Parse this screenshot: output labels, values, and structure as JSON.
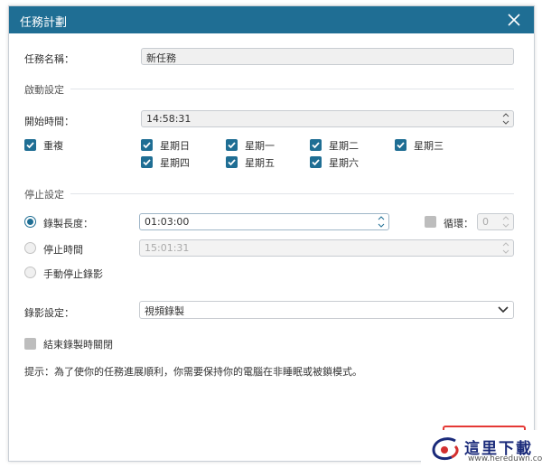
{
  "dialog": {
    "title": "任務計劃",
    "task_name_label": "任務名稱：",
    "task_name_value": "新任務",
    "start_section": "啟動設定",
    "start_time_label": "開始時間：",
    "start_time_value": "14:58:31",
    "repeat_label": "重複",
    "days": [
      "星期日",
      "星期一",
      "星期二",
      "星期三",
      "星期四",
      "星期五",
      "星期六"
    ],
    "stop_section": "停止設定",
    "duration_label": "錄製長度：",
    "duration_value": "01:03:00",
    "loop_label": "循環：",
    "loop_value": "0",
    "stop_time_label": "停止時間",
    "stop_time_value": "15:01:31",
    "manual_stop_label": "手動停止錄影",
    "record_settings_label": "錄影設定：",
    "record_settings_value": "視頻錄製",
    "close_after_label": "結束錄製時關閉",
    "hint": "提示：為了使你的任務進展順利，你需要保持你的電腦在非睡眠或被鎖模式。"
  },
  "watermark": {
    "text": "這里下載",
    "url": "www.hereduwn.com"
  },
  "colors": {
    "titlebar": "#1f6e94",
    "accent": "#1f6e94",
    "highlight": "#e53935"
  }
}
